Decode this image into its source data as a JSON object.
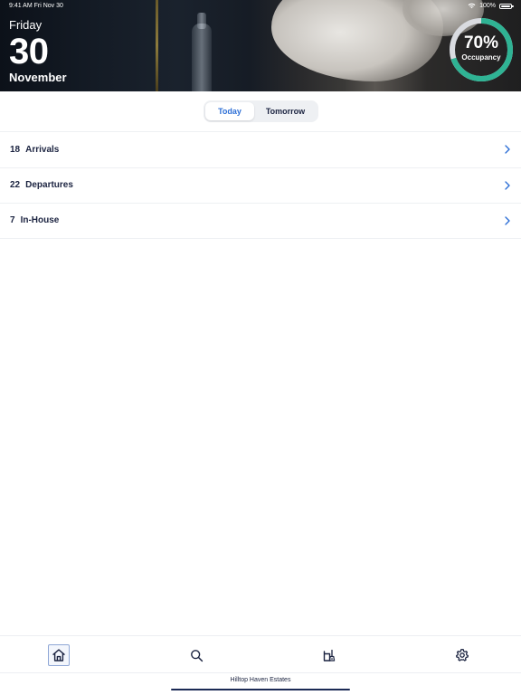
{
  "status_bar": {
    "time_date": "9:41 AM Fri Nov 30",
    "battery": "100%",
    "icons": [
      "wifi-icon",
      "battery-icon"
    ]
  },
  "header": {
    "weekday": "Friday",
    "day": "30",
    "month": "November",
    "occupancy": {
      "value": "70%",
      "label": "Occupancy",
      "fraction": 0.7,
      "ring_color": "#2fb394",
      "track_color": "#d9dbe0"
    }
  },
  "segmented": {
    "options": [
      "Today",
      "Tomorrow"
    ],
    "selected": "Today",
    "selected_color": "#2d6fd6"
  },
  "list": {
    "rows": [
      {
        "count": "18",
        "label": "Arrivals"
      },
      {
        "count": "22",
        "label": "Departures"
      },
      {
        "count": "7",
        "label": "In-House"
      }
    ],
    "chevron_color": "#2d6fd6"
  },
  "tabbar": {
    "items": [
      {
        "icon": "home-icon",
        "active": true
      },
      {
        "icon": "search-icon",
        "active": false
      },
      {
        "icon": "housekeeping-icon",
        "active": false
      },
      {
        "icon": "gear-icon",
        "active": false
      }
    ]
  },
  "footer": {
    "property_name": "Hilltop Haven Estates"
  }
}
